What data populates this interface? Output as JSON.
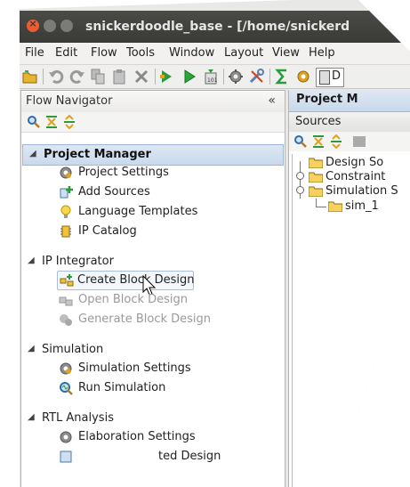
{
  "window": {
    "title": "snickerdoodle_base - [/home/snickerd"
  },
  "menubar": [
    {
      "label": "File"
    },
    {
      "label": "Edit"
    },
    {
      "label": "Flow"
    },
    {
      "label": "Tools"
    },
    {
      "label": "Window"
    },
    {
      "label": "Layout"
    },
    {
      "label": "View"
    },
    {
      "label": "Help"
    }
  ],
  "toolbar": {
    "dropdown_label": "D"
  },
  "flow_navigator": {
    "title": "Flow Navigator",
    "collapse_glyph": "«",
    "sections": [
      {
        "label": "Project Manager",
        "arrow": "◢",
        "items": [
          {
            "label": "Project Settings",
            "icon": "gear-icon"
          },
          {
            "label": "Add Sources",
            "icon": "add-sources-icon"
          },
          {
            "label": "Language Templates",
            "icon": "lightbulb-icon"
          },
          {
            "label": "IP Catalog",
            "icon": "ip-catalog-icon"
          }
        ]
      },
      {
        "label": "IP Integrator",
        "arrow": "◢",
        "items": [
          {
            "label": "Create Block Design",
            "icon": "create-block-icon"
          },
          {
            "label": "Open Block Design",
            "icon": "open-block-icon"
          },
          {
            "label": "Generate Block Design",
            "icon": "generate-block-icon"
          }
        ]
      },
      {
        "label": "Simulation",
        "arrow": "◢",
        "items": [
          {
            "label": "Simulation Settings",
            "icon": "gear-icon"
          },
          {
            "label": "Run Simulation",
            "icon": "run-simulation-icon"
          }
        ]
      },
      {
        "label": "RTL Analysis",
        "arrow": "◢",
        "items": [
          {
            "label": "Elaboration Settings",
            "icon": "gear-icon"
          },
          {
            "label": "ted Design",
            "icon": "elaborated-design-icon"
          }
        ]
      }
    ]
  },
  "right_panel": {
    "tab_label": "Project M",
    "sources_label": "Sources",
    "tree": [
      {
        "label": "Design So"
      },
      {
        "label": "Constraint"
      },
      {
        "label": "Simulation S"
      },
      {
        "label": "sim_1"
      }
    ]
  }
}
